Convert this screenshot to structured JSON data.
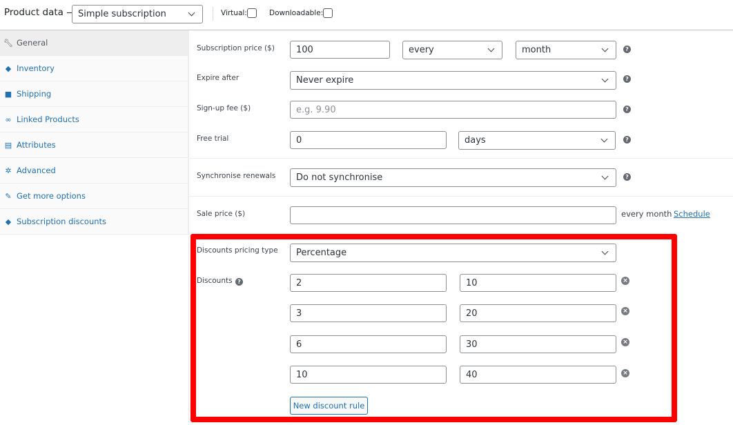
{
  "header": {
    "title": "Product data —",
    "product_type": "Simple subscription",
    "virtual_label": "Virtual:",
    "downloadable_label": "Downloadable:"
  },
  "sidebar": {
    "items": [
      {
        "label": "General",
        "icon": "wrench-icon"
      },
      {
        "label": "Inventory",
        "icon": "tag-icon"
      },
      {
        "label": "Shipping",
        "icon": "truck-icon"
      },
      {
        "label": "Linked Products",
        "icon": "link-icon"
      },
      {
        "label": "Attributes",
        "icon": "list-icon"
      },
      {
        "label": "Advanced",
        "icon": "gear-icon"
      },
      {
        "label": "Get more options",
        "icon": "plug-icon"
      },
      {
        "label": "Subscription discounts",
        "icon": "tag-icon"
      }
    ]
  },
  "fields": {
    "subscription_price": {
      "label": "Subscription price ($)",
      "value": "100",
      "interval": "every",
      "period": "month"
    },
    "expire_after": {
      "label": "Expire after",
      "value": "Never expire"
    },
    "signup_fee": {
      "label": "Sign-up fee ($)",
      "placeholder": "e.g. 9.90"
    },
    "free_trial": {
      "label": "Free trial",
      "value": "0",
      "period": "days"
    },
    "sync": {
      "label": "Synchronise renewals",
      "value": "Do not synchronise"
    },
    "sale_price": {
      "label": "Sale price ($)",
      "value": "",
      "suffix": "every month",
      "schedule_link": "Schedule"
    },
    "discount_type": {
      "label": "Discounts pricing type",
      "value": "Percentage"
    },
    "discounts": {
      "label": "Discounts",
      "rules": [
        {
          "qty": "2",
          "amount": "10"
        },
        {
          "qty": "3",
          "amount": "20"
        },
        {
          "qty": "6",
          "amount": "30"
        },
        {
          "qty": "10",
          "amount": "40"
        }
      ],
      "new_rule_label": "New discount rule"
    }
  },
  "colors": {
    "highlight": "#ff0000",
    "link": "#2271b1"
  }
}
